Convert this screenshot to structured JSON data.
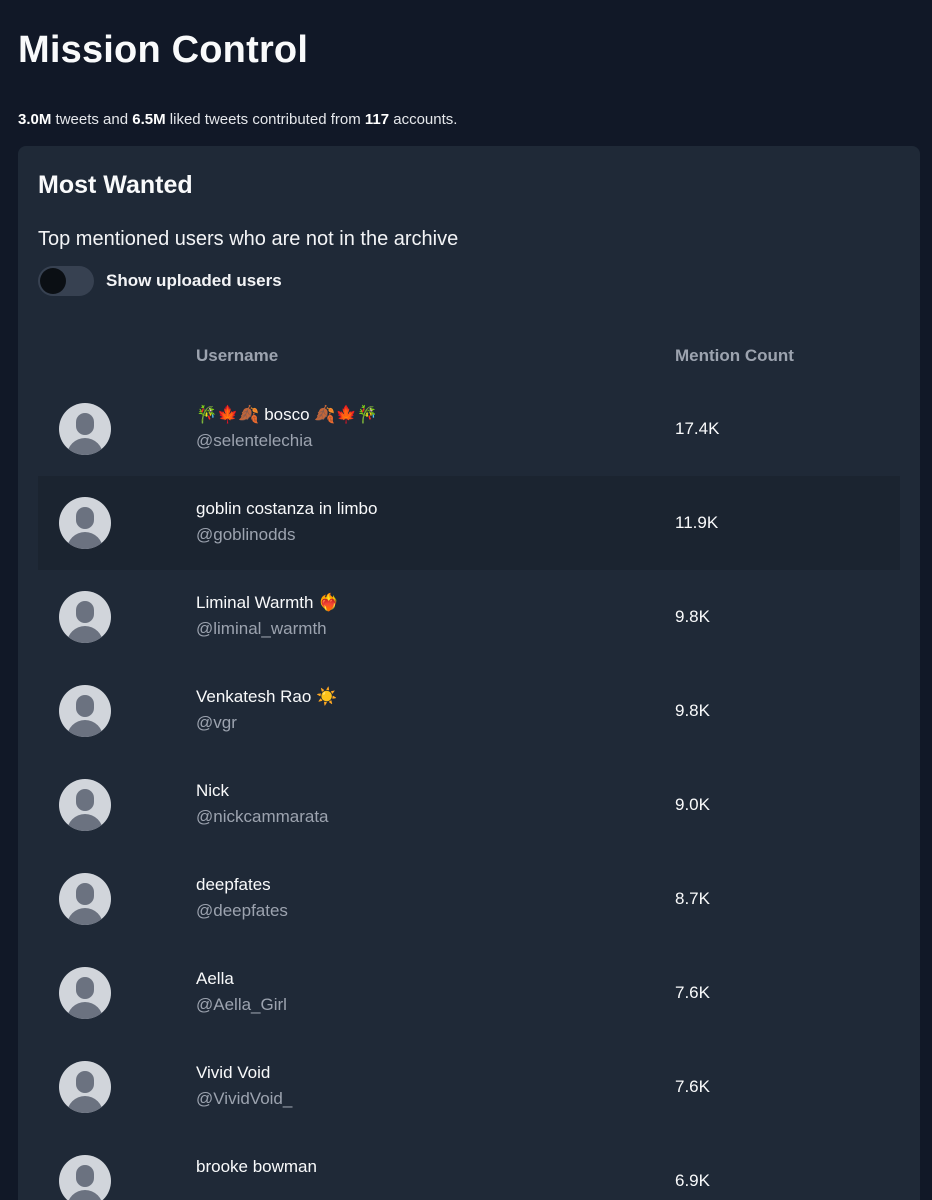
{
  "header": {
    "title": "Mission Control",
    "stats": {
      "tweets": "3.0M",
      "tweets_label": "tweets and",
      "liked": "6.5M",
      "liked_label": "liked tweets contributed from",
      "accounts": "117",
      "accounts_label": "accounts."
    }
  },
  "card": {
    "title": "Most Wanted",
    "subtitle": "Top mentioned users who are not in the archive",
    "toggle": {
      "label": "Show uploaded users",
      "checked": false
    },
    "columns": {
      "username": "Username",
      "count": "Mention Count"
    },
    "rows": [
      {
        "name": "🎋🍁🍂 bosco 🍂🍁🎋",
        "handle": "@selentelechia",
        "count": "17.4K"
      },
      {
        "name": "goblin costanza in limbo",
        "handle": "@goblinodds",
        "count": "11.9K"
      },
      {
        "name": "Liminal Warmth ❤️‍🔥",
        "handle": "@liminal_warmth",
        "count": "9.8K"
      },
      {
        "name": "Venkatesh Rao ☀️",
        "handle": "@vgr",
        "count": "9.8K"
      },
      {
        "name": "Nick",
        "handle": "@nickcammarata",
        "count": "9.0K"
      },
      {
        "name": "deepfates",
        "handle": "@deepfates",
        "count": "8.7K"
      },
      {
        "name": "Aella",
        "handle": "@Aella_Girl",
        "count": "7.6K"
      },
      {
        "name": "Vivid Void",
        "handle": "@VividVoid_",
        "count": "7.6K"
      },
      {
        "name": "brooke bowman",
        "handle": "",
        "count": "6.9K"
      }
    ]
  }
}
